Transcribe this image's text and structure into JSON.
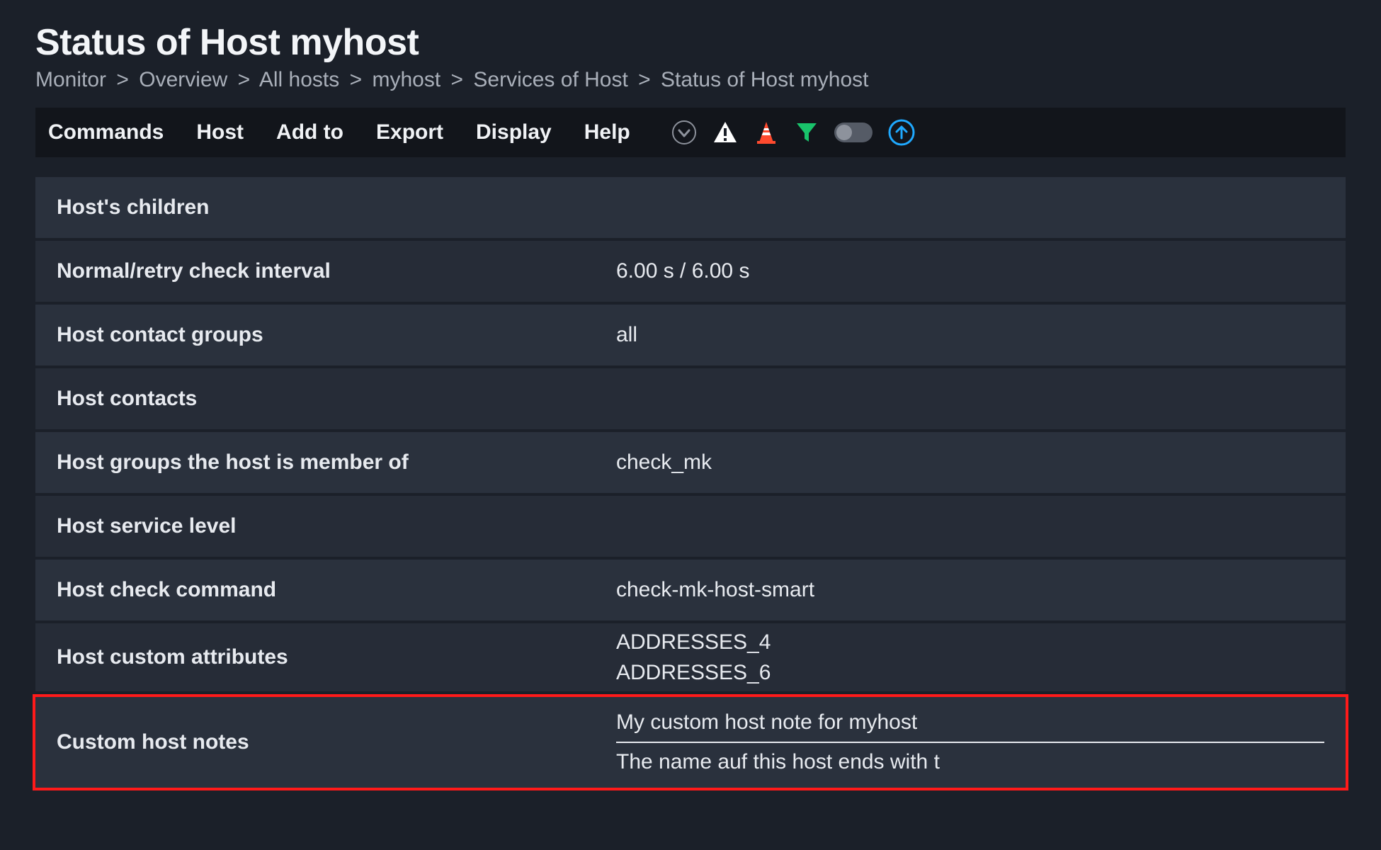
{
  "page": {
    "title": "Status of Host myhost"
  },
  "breadcrumb": {
    "items": [
      "Monitor",
      "Overview",
      "All hosts",
      "myhost",
      "Services of Host",
      "Status of Host myhost"
    ],
    "sep": ">"
  },
  "menu": {
    "items": [
      "Commands",
      "Host",
      "Add to",
      "Export",
      "Display",
      "Help"
    ]
  },
  "icons": {
    "dropdown": "chevron-down",
    "warning": "warning-triangle",
    "cone": "traffic-cone",
    "filter": "funnel",
    "toggle": "off",
    "up": "arrow-up-circle"
  },
  "rows": {
    "host_children": {
      "label": "Host's children",
      "value": ""
    },
    "check_interval": {
      "label": "Normal/retry check interval",
      "value": "6.00 s / 6.00 s"
    },
    "contact_groups": {
      "label": "Host contact groups",
      "value": "all"
    },
    "contacts": {
      "label": "Host contacts",
      "value": ""
    },
    "host_groups": {
      "label": "Host groups the host is member of",
      "value": "check_mk"
    },
    "service_level": {
      "label": "Host service level",
      "value": ""
    },
    "check_command": {
      "label": "Host check command",
      "value": "check-mk-host-smart"
    },
    "custom_attrs": {
      "label": "Host custom attributes",
      "value_lines": [
        "ADDRESSES_4",
        "ADDRESSES_6"
      ]
    },
    "custom_notes": {
      "label": "Custom host notes",
      "notes": [
        "My custom host note for myhost",
        "The name auf this host ends with t"
      ]
    }
  }
}
